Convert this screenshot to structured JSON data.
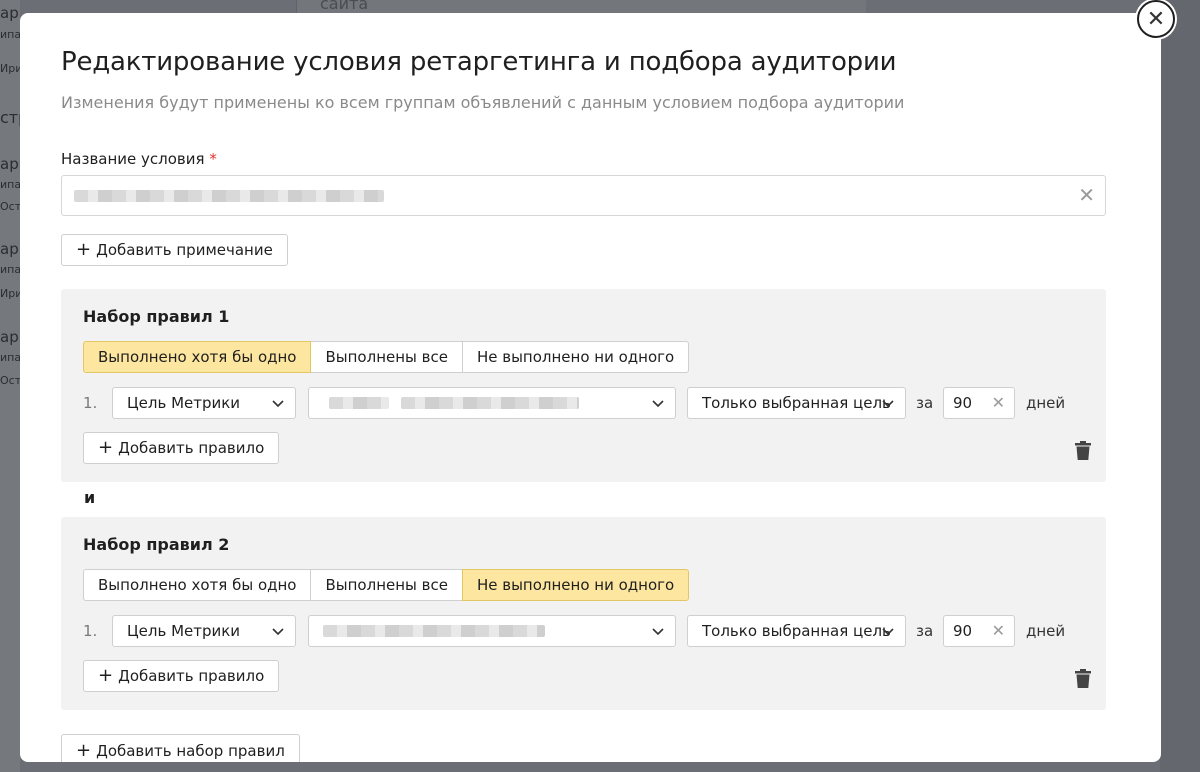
{
  "background": {
    "top_text": "сайта",
    "left_fragments": [
      "аргети",
      "ипа",
      "Ири",
      "стр",
      "ар",
      "ипа",
      "Оста",
      "ар",
      "ипа",
      "Ири",
      "ар",
      "ипа",
      "Оста"
    ]
  },
  "modal": {
    "title": "Редактирование условия ретаргетинга и подбора аудитории",
    "subtitle": "Изменения будут применены ко всем группам объявлений с данным условием подбора аудитории",
    "name_label": "Название условия",
    "required_mark": "*",
    "add_note_label": "Добавить примечание",
    "and_label": "и",
    "add_ruleset_label": "Добавить набор правил"
  },
  "rulesets": [
    {
      "title": "Набор правил 1",
      "segments": [
        "Выполнено хотя бы одно",
        "Выполнены все",
        "Не выполнено ни одного"
      ],
      "active_segment": 0,
      "rule": {
        "number": "1.",
        "type": "Цель Метрики",
        "scope": "Только выбранная цель",
        "za": "за",
        "days_value": "90",
        "days_label": "дней"
      },
      "add_rule_label": "Добавить правило"
    },
    {
      "title": "Набор правил 2",
      "segments": [
        "Выполнено хотя бы одно",
        "Выполнены все",
        "Не выполнено ни одного"
      ],
      "active_segment": 2,
      "rule": {
        "number": "1.",
        "type": "Цель Метрики",
        "scope": "Только выбранная цель",
        "za": "за",
        "days_value": "90",
        "days_label": "дней"
      },
      "add_rule_label": "Добавить правило"
    }
  ],
  "icons": {
    "close": "close-icon",
    "clear": "clear-icon",
    "plus": "plus-icon",
    "chevron": "chevron-down-icon",
    "trash": "trash-icon"
  },
  "colors": {
    "active_segment_bg": "#fde7a0",
    "active_segment_border": "#e2c766",
    "required": "#e0312b",
    "ruleset_bg": "#f2f2f2"
  }
}
